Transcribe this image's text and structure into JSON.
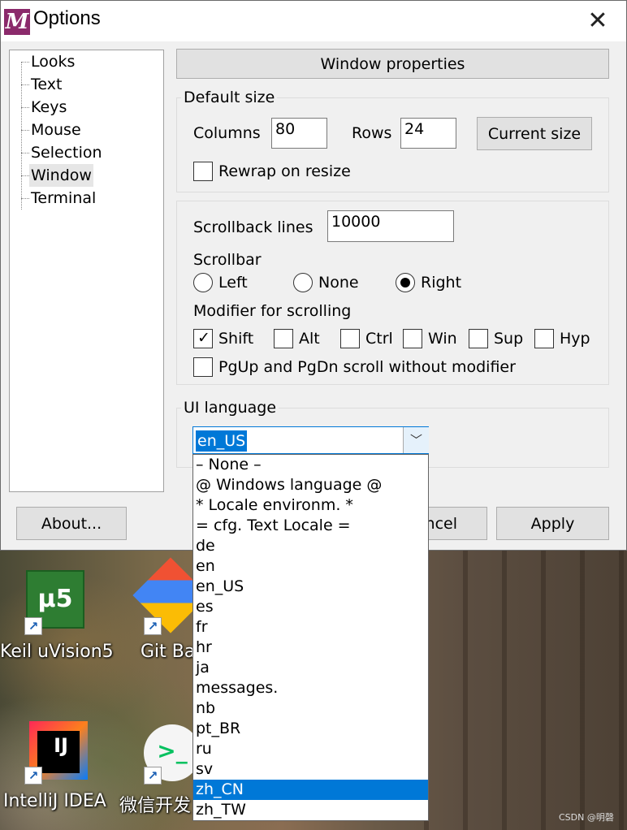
{
  "window": {
    "title": "Options",
    "app_icon_letter": "M",
    "close_glyph": "✕"
  },
  "tree": {
    "items": [
      "Looks",
      "Text",
      "Keys",
      "Mouse",
      "Selection",
      "Window",
      "Terminal"
    ],
    "selected": "Window"
  },
  "header_button": "Window properties",
  "default_size": {
    "title": "Default size",
    "columns_label": "Columns",
    "columns_value": "80",
    "rows_label": "Rows",
    "rows_value": "24",
    "current_size_button": "Current size",
    "rewrap_label": "Rewrap on resize",
    "rewrap_checked": false
  },
  "scrolling": {
    "scrollback_label": "Scrollback lines",
    "scrollback_value": "10000",
    "scrollbar_label": "Scrollbar",
    "scrollbar_options": [
      "Left",
      "None",
      "Right"
    ],
    "scrollbar_selected": "Right",
    "modifier_label": "Modifier for scrolling",
    "modifiers": [
      {
        "label": "Shift",
        "checked": true
      },
      {
        "label": "Alt",
        "checked": false
      },
      {
        "label": "Ctrl",
        "checked": false
      },
      {
        "label": "Win",
        "checked": false
      },
      {
        "label": "Sup",
        "checked": false
      },
      {
        "label": "Hyp",
        "checked": false
      }
    ],
    "pgup_label": "PgUp and PgDn scroll without modifier",
    "pgup_checked": false
  },
  "ui_language": {
    "title": "UI language",
    "value": "en_US",
    "options": [
      "– None –",
      "@ Windows language @",
      "* Locale environm. *",
      "= cfg. Text Locale =",
      "de",
      "en",
      "en_US",
      "es",
      "fr",
      "hr",
      "ja",
      "messages.",
      "nb",
      "pt_BR",
      "ru",
      "sv",
      "zh_CN",
      "zh_TW"
    ],
    "highlighted": "zh_CN"
  },
  "footer": {
    "about_button": "About...",
    "cancel_button_visible": "ncel",
    "apply_button": "Apply"
  },
  "desktop": {
    "icons": [
      {
        "label": "Keil uVision5",
        "icon_text": "µ5"
      },
      {
        "label": "Git Ba"
      },
      {
        "label": "IntelliJ IDEA",
        "icon_text": "IJ"
      },
      {
        "label": "微信开发"
      }
    ]
  },
  "watermark": "CSDN @明磬",
  "colors": {
    "accent": "#0078d7",
    "app_icon": "#8b2a6b",
    "window_bg": "#f0f0f0"
  }
}
